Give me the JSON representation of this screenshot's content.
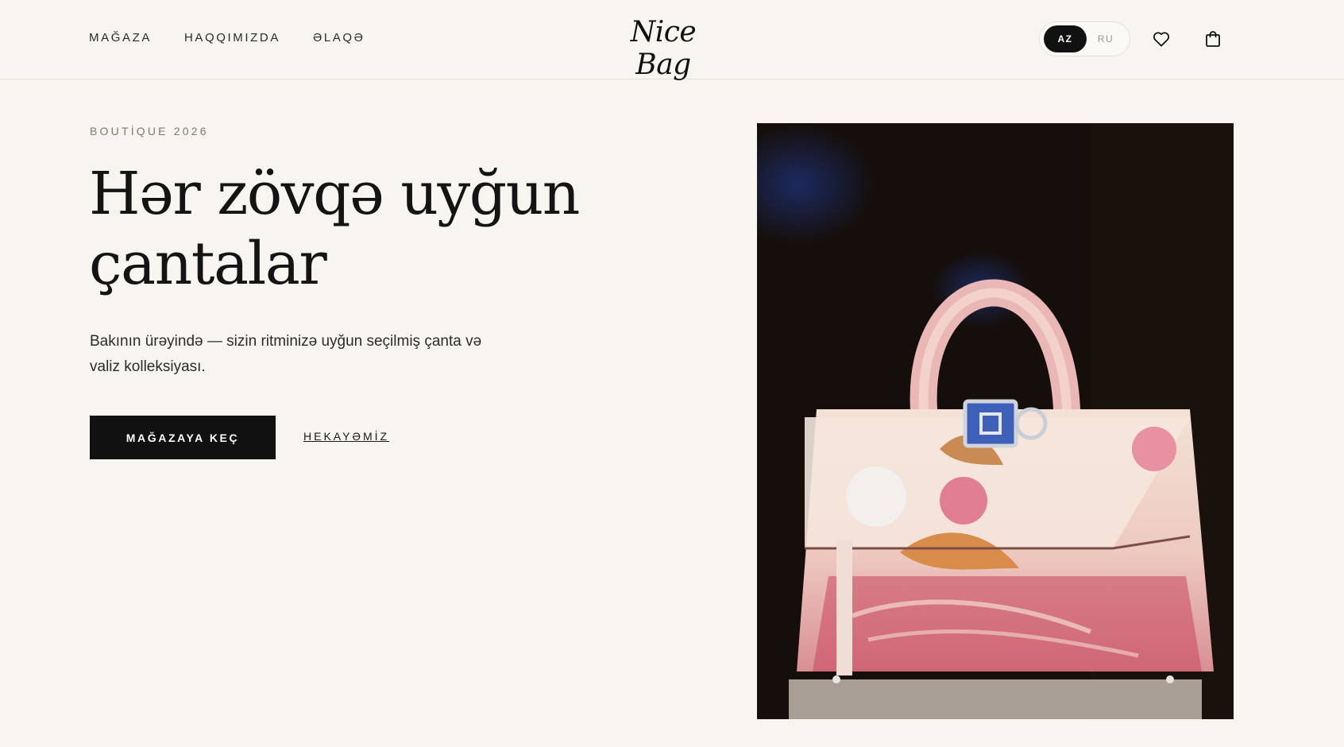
{
  "header": {
    "nav": [
      "MAĞAZA",
      "HAQQIMIZDA",
      "ƏLAQƏ"
    ],
    "logo": "Nice Bag",
    "languages": [
      "AZ",
      "RU"
    ],
    "active_language": "AZ"
  },
  "hero": {
    "eyebrow": "BOUTİQUE 2026",
    "headline_line1": "Hər zövqə uyğun",
    "headline_line2": "çantalar",
    "description_line1": "Bakının ürəyində — sizin ritminizə uyğun seçilmiş çanta və",
    "description_line2": "valiz kolleksiyası.",
    "primary_cta": "MAĞAZAYA KEÇ",
    "secondary_cta": "HEKAYƏMİZ"
  },
  "icons": {
    "wishlist": "heart-icon",
    "cart": "shopping-bag-icon"
  },
  "colors": {
    "background": "#f8f5f1",
    "primary": "#111111"
  }
}
